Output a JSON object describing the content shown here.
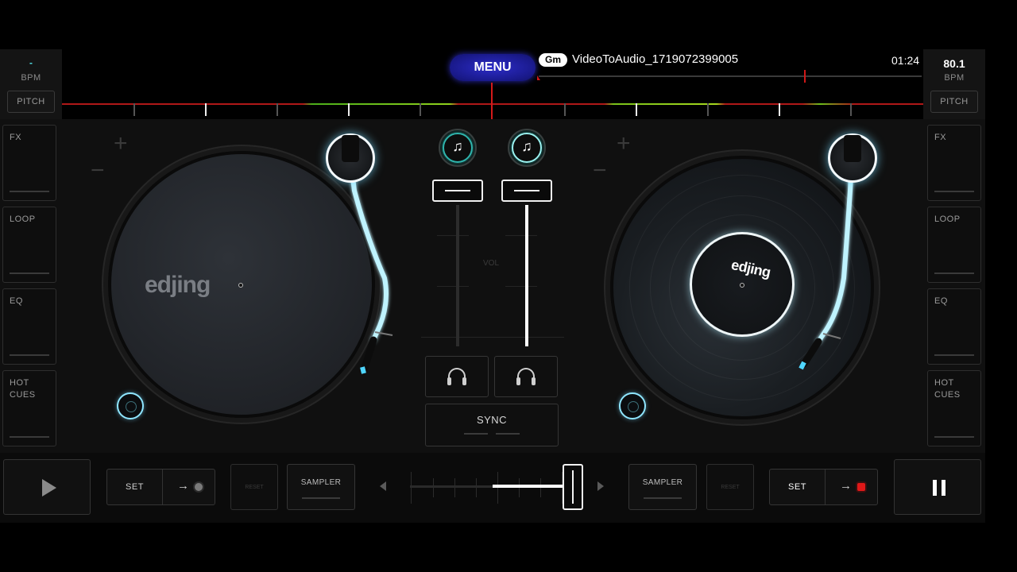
{
  "deck_left": {
    "bpm": "-",
    "bpm_label": "BPM",
    "pitch_label": "PITCH",
    "pads": [
      "FX",
      "LOOP",
      "EQ",
      "HOT\nCUES"
    ],
    "logo": "edjing",
    "set_label": "SET",
    "reset_label": "RESET",
    "sampler_label": "SAMPLER",
    "cue_dot_color": "#7a7a7a"
  },
  "deck_right": {
    "bpm": "80.1",
    "bpm_label": "BPM",
    "pitch_label": "PITCH",
    "pads": [
      "FX",
      "LOOP",
      "EQ",
      "HOT\nCUES"
    ],
    "logo": "edjing",
    "set_label": "SET",
    "reset_label": "RESET",
    "sampler_label": "SAMPLER",
    "cue_dot_color": "#e01818"
  },
  "header": {
    "menu_label": "MENU",
    "source_badge": "Gm",
    "track_title": "VideoToAudio_1719072399005",
    "track_time": "01:24"
  },
  "mixer": {
    "vol_label": "VOL",
    "sync_label": "SYNC",
    "fx_icon_left": "music-note-plus-icon",
    "fx_icon_right": "music-note-plus-icon",
    "left_volume_level": 0.0,
    "right_volume_level": 1.0,
    "crossfader_position": 0.97
  },
  "transport": {
    "left_state": "play",
    "right_state": "pause"
  },
  "colors": {
    "accent": "#8fe6ff",
    "menu": "#1a1a8c",
    "playhead": "#d41a1a"
  }
}
